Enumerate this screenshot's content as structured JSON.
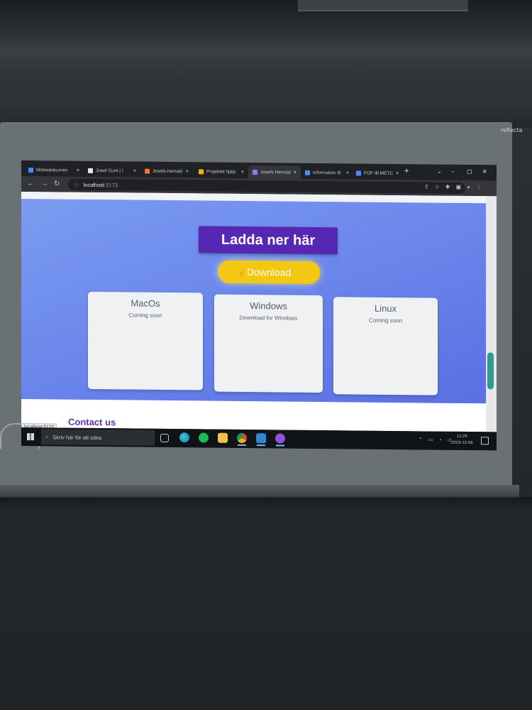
{
  "projector": {
    "brand": "reflecta"
  },
  "browser": {
    "tabs": [
      {
        "title": "Mötesdokumen",
        "favicon_color": "#4d8cf5"
      },
      {
        "title": "Josef Cure | \\",
        "favicon_color": "#e7e8ea"
      },
      {
        "title": "Josefs-hemsid",
        "favicon_color": "#e37933"
      },
      {
        "title": "Projektet hjälp",
        "favicon_color": "#f4b400"
      },
      {
        "title": "Josefs Hemsid",
        "favicon_color": "#8f7bea",
        "active": true
      },
      {
        "title": "Information fö",
        "favicon_color": "#4d8cf5"
      },
      {
        "title": "FOF till METC",
        "favicon_color": "#4d8cf5"
      }
    ],
    "tab_close_glyph": "×",
    "new_tab_glyph": "+",
    "url_host": "localhost",
    "url_port": ":5173",
    "window_controls": [
      "⌄",
      "–",
      "▢",
      "✕"
    ]
  },
  "page": {
    "heading": "Ladda ner här",
    "download_button": "Download",
    "cards": [
      {
        "title": "MacOs",
        "text": "Coming soon"
      },
      {
        "title": "Windows",
        "text": "Download for Windows"
      },
      {
        "title": "Linux",
        "text": "Coming soon"
      }
    ],
    "contact_heading": "Contact us",
    "status_url": "localhost:5173",
    "colors": {
      "heading_bg": "#5627b3",
      "button_bg": "#f2c812",
      "hero_bg": "#6c88ec",
      "scroll_thumb": "#2c9b95"
    }
  },
  "taskbar": {
    "search_placeholder": "Skriv här för att söka",
    "time": "12:25",
    "date": "2023-12-06",
    "apps": [
      "task-view-icon",
      "edge-icon",
      "spotify-icon",
      "file-explorer-icon",
      "chrome-icon",
      "vscode-icon",
      "github-desktop-icon"
    ]
  }
}
